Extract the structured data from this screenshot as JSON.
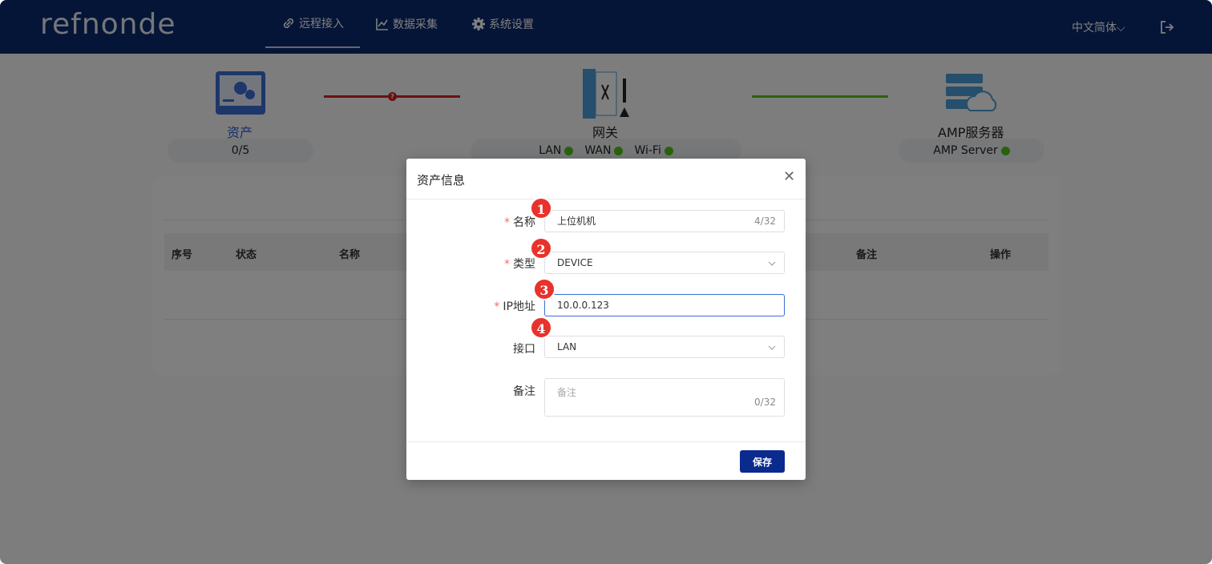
{
  "header": {
    "logo_text": "refnonde",
    "nav": [
      {
        "label": "远程接入",
        "icon": "link-icon",
        "active": true
      },
      {
        "label": "数据采集",
        "icon": "chart-icon",
        "active": false
      },
      {
        "label": "系统设置",
        "icon": "gear-icon",
        "active": false
      }
    ],
    "language": "中文简体",
    "logout_icon": "logout-icon"
  },
  "topology": {
    "asset": {
      "label": "资产",
      "count": "0/5",
      "icon": "asset-icon"
    },
    "gateway": {
      "label": "网关",
      "lan": "LAN",
      "wan": "WAN",
      "wifi": "Wi-Fi",
      "icon": "gateway-icon"
    },
    "server": {
      "label": "AMP服务器",
      "status": "AMP Server",
      "icon": "server-cloud-icon"
    },
    "colors": {
      "error_line": "#d42020",
      "ok_line": "#52c41a",
      "ok_dot": "#52c41a"
    }
  },
  "table": {
    "columns": [
      "序号",
      "状态",
      "名称",
      "备注",
      "操作"
    ]
  },
  "modal": {
    "title": "资产信息",
    "fields": {
      "name": {
        "label": "名称",
        "value": "上位机机",
        "counter": "4/32",
        "required": true,
        "marker": "1"
      },
      "type": {
        "label": "类型",
        "value": "DEVICE",
        "required": true,
        "marker": "2"
      },
      "ip": {
        "label": "IP地址",
        "value": "10.0.0.123",
        "required": true,
        "marker": "3"
      },
      "iface": {
        "label": "接口",
        "value": "LAN",
        "required": false,
        "marker": "4"
      },
      "remark": {
        "label": "备注",
        "placeholder": "备注",
        "counter": "0/32",
        "required": false
      }
    },
    "save_label": "保存",
    "accent": "#0a2a8e"
  }
}
